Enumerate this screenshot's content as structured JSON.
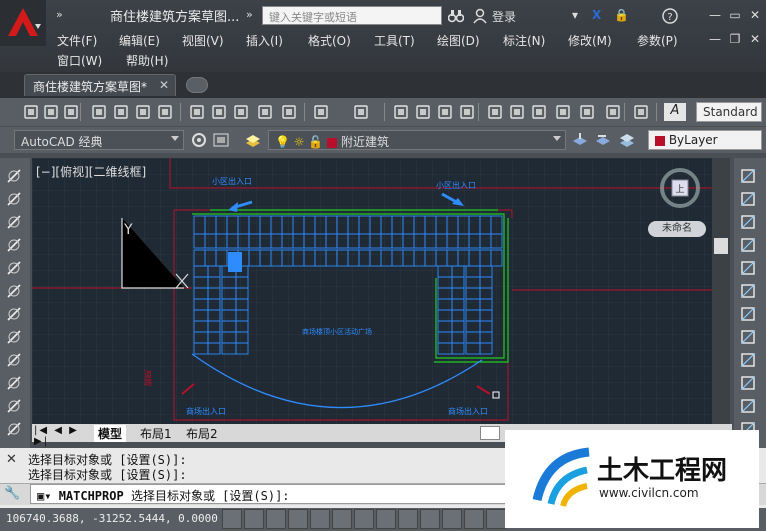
{
  "window": {
    "title": "商住楼建筑方案草图...",
    "search_placeholder": "键入关键字或短语",
    "login": "登录"
  },
  "menu": [
    "文件(F)",
    "编辑(E)",
    "视图(V)",
    "插入(I)",
    "格式(O)",
    "工具(T)",
    "绘图(D)",
    "标注(N)",
    "修改(M)",
    "参数(P)",
    "窗口(W)",
    "帮助(H)"
  ],
  "tab": {
    "label": "商住楼建筑方案草图*"
  },
  "toolbar": {
    "text_style": "Standard",
    "workspace": "AutoCAD 经典",
    "layer": "附近建筑",
    "color": "ByLayer"
  },
  "view": {
    "label": "[−][俯视][二维线框]",
    "named_view": "未命名"
  },
  "drawing": {
    "axis_y": "Y",
    "label_small_entry1": "小区出入口",
    "label_small_entry2": "小区出入口",
    "label_plaza": "商场楼顶小区活动广场",
    "label_mall_entry1": "商场出入口",
    "label_mall_entry2": "商场出入口",
    "label_red": "道路"
  },
  "layout_tabs": [
    "模型",
    "布局1",
    "布局2"
  ],
  "command": {
    "history1": "选择目标对象或 [设置(S)]:",
    "history2": "选择目标对象或 [设置(S)]:",
    "prompt_cmd": "MATCHPROP",
    "prompt_text": "选择目标对象或 [设置(S)]:"
  },
  "status": {
    "coords": "106740.3688, -31252.5444, 0.0000"
  },
  "watermark": {
    "brand": "土木工程网",
    "url": "www.civilcn.com"
  },
  "colors": {
    "canvas": "#202a34",
    "building": "#2e8cff",
    "green": "#22cc22",
    "red": "#b8102a"
  }
}
